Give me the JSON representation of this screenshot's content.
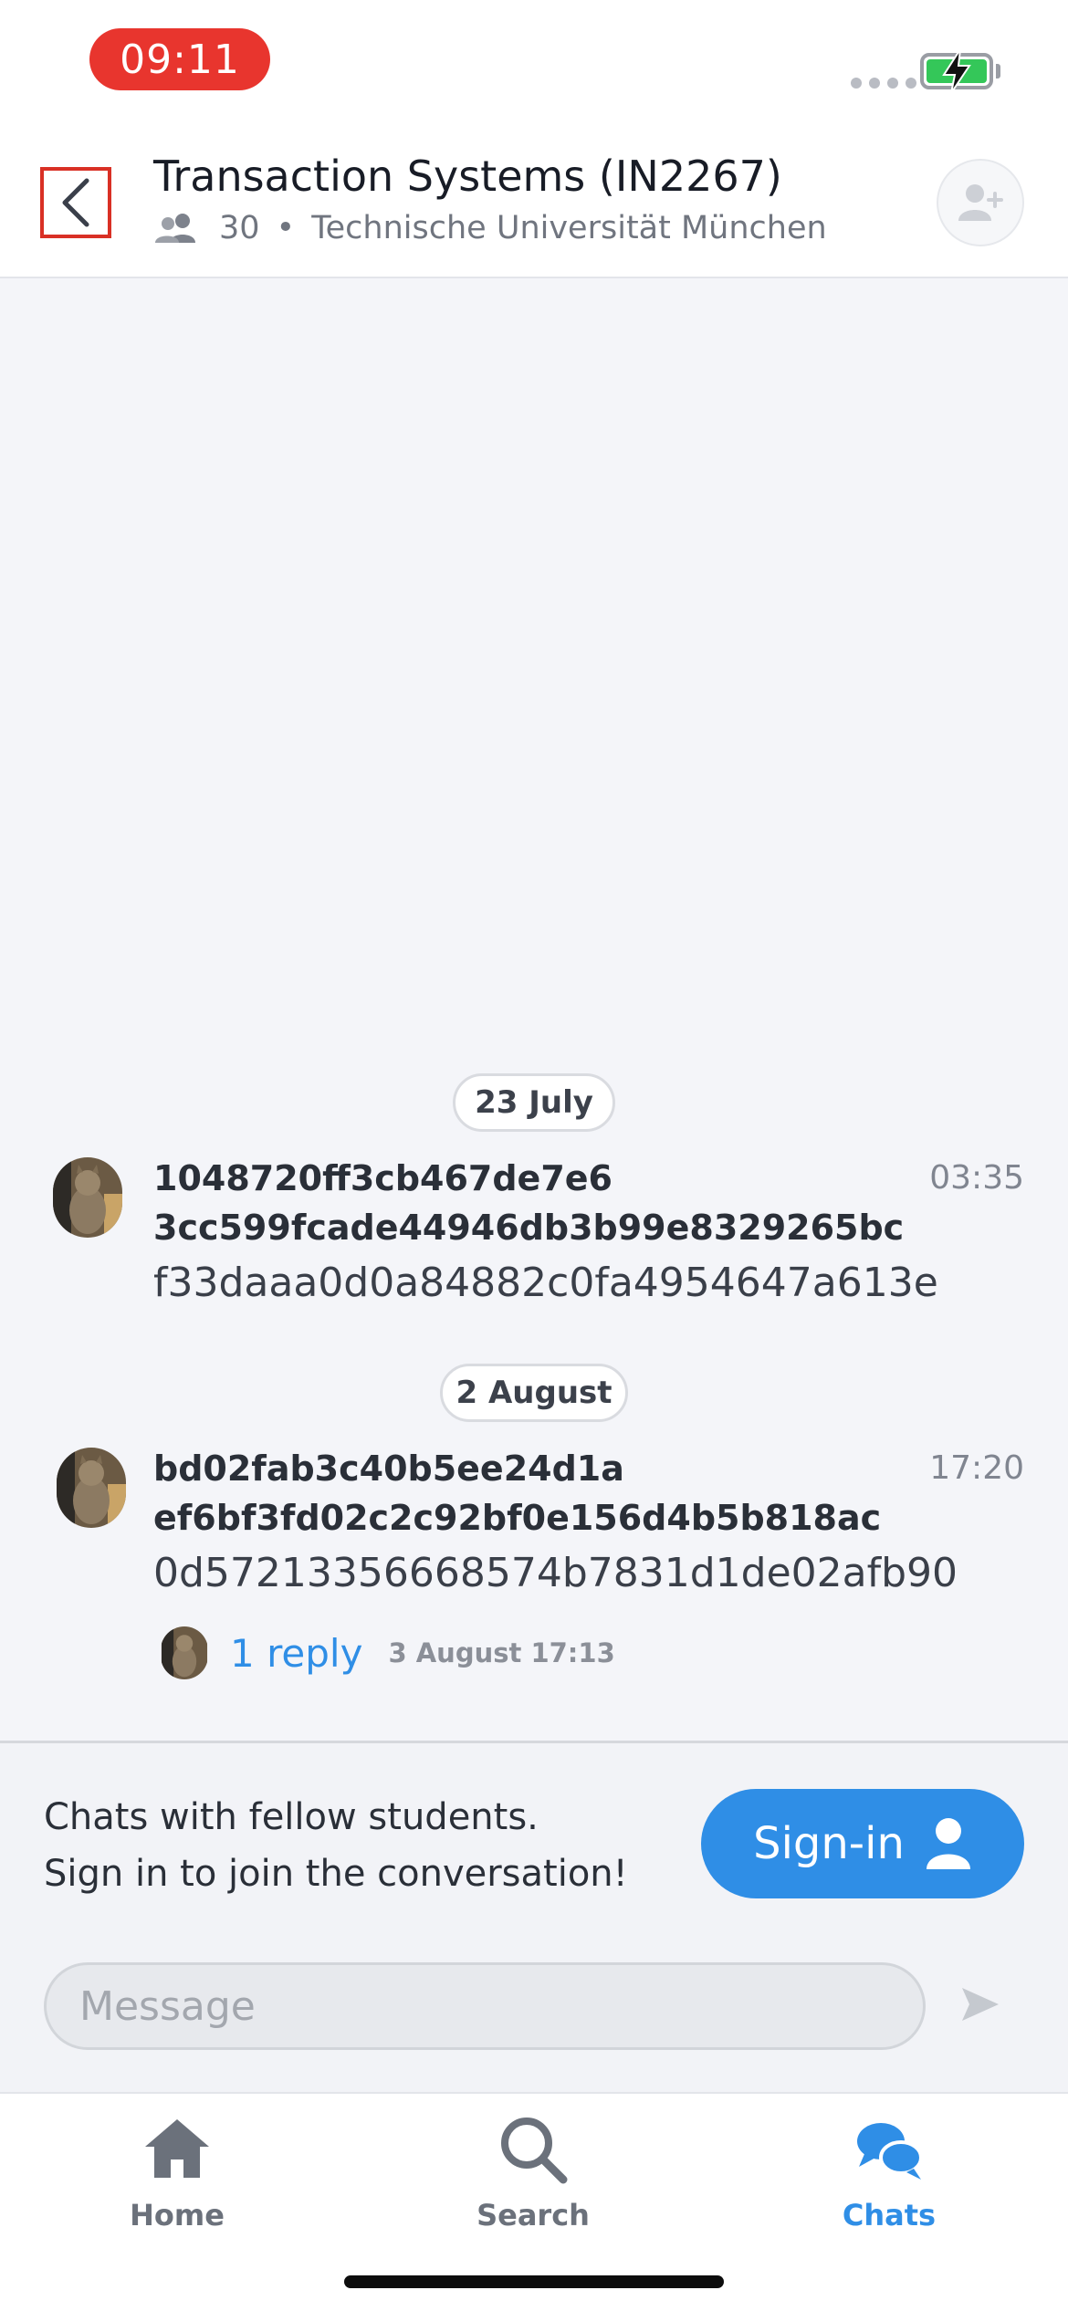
{
  "status_bar": {
    "time": "09:11"
  },
  "header": {
    "title": "Transaction Systems (IN2267)",
    "member_count": "30",
    "separator": "•",
    "university": "Technische Universität München"
  },
  "messages": [
    {
      "date": "23 July",
      "name_line1": "1048720ff3cb467de7e6",
      "name_line2": "3cc599fcade44946db3b99e8329265bc",
      "time": "03:35",
      "text": "f33daaa0d0a84882c0fa4954647a613e"
    },
    {
      "date": "2 August",
      "name_line1": "bd02fab3c40b5ee24d1a",
      "name_line2": "ef6bf3fd02c2c92bf0e156d4b5b818ac",
      "time": "17:20",
      "text": "0d57213356668574b7831d1de02afb90",
      "reply": {
        "label": "1 reply",
        "time": "3 August 17:13"
      }
    }
  ],
  "banner": {
    "line1": "Chats with fellow students.",
    "line2": "Sign in to join the conversation!",
    "signin_label": "Sign-in"
  },
  "composer": {
    "placeholder": "Message"
  },
  "tabs": [
    {
      "label": "Home",
      "icon": "home-icon",
      "active": false
    },
    {
      "label": "Search",
      "icon": "search-icon",
      "active": false
    },
    {
      "label": "Chats",
      "icon": "chats-icon",
      "active": true
    }
  ],
  "colors": {
    "accent": "#2f8ee6",
    "time_pill": "#e8352e",
    "battery": "#34c759"
  }
}
